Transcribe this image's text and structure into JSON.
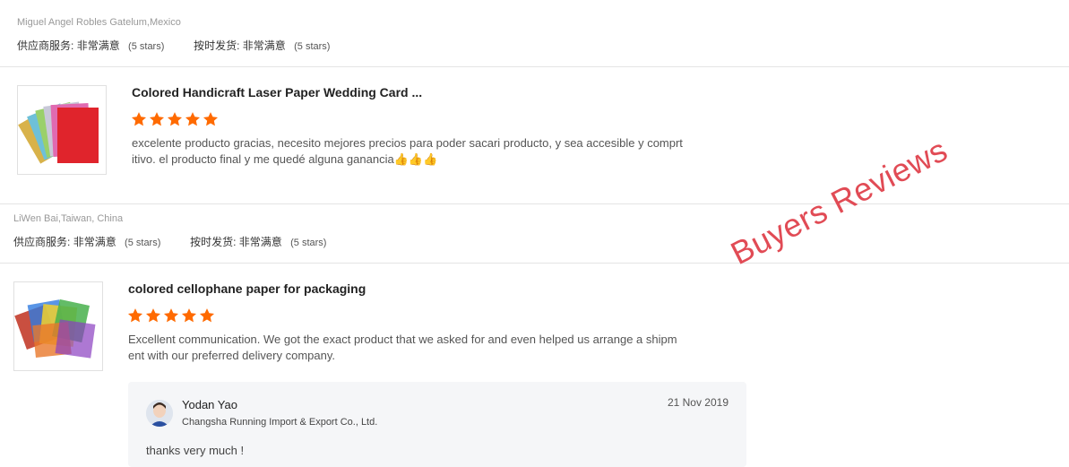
{
  "reviews": [
    {
      "buyer": "Miguel Angel Robles Gatelum,Mexico",
      "supplier_service_label": "供应商服务:",
      "supplier_service_value": "非常满意",
      "supplier_service_stars": "(5 stars)",
      "ontime_label": "按时发货:",
      "ontime_value": "非常满意",
      "ontime_stars": "(5 stars)",
      "product_title": "Colored Handicraft Laser Paper Wedding Card ...",
      "rating": 5,
      "text_line1": "excelente producto gracias, necesito mejores precios para poder sacari producto, y sea accesible y comprt",
      "text_line2": "itivo. el producto final y me quedé alguna ganancia👍👍👍"
    },
    {
      "buyer": "LiWen Bai,Taiwan, China",
      "supplier_service_label": "供应商服务:",
      "supplier_service_value": "非常满意",
      "supplier_service_stars": "(5 stars)",
      "ontime_label": "按时发货:",
      "ontime_value": "非常满意",
      "ontime_stars": "(5 stars)",
      "product_title": "colored cellophane paper for packaging",
      "rating": 5,
      "text_line1": "Excellent communication. We got the exact product that we asked for and even helped us arrange a shipm",
      "text_line2": "ent with our preferred delivery company.",
      "reply": {
        "name": "Yodan Yao",
        "company": "Changsha Running Import & Export Co., Ltd.",
        "date": "21 Nov 2019",
        "text": "thanks very much !"
      }
    }
  ],
  "watermark": "Buyers Reviews",
  "colors": {
    "star": "#ff6a00",
    "watermark": "#e14b55",
    "divider": "#e4e4e4"
  }
}
